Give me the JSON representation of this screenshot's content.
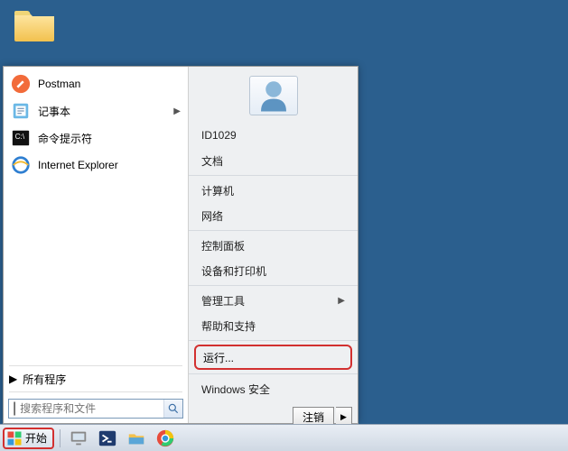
{
  "desktop": {
    "folder_icon": "folder-icon"
  },
  "start_menu": {
    "left": {
      "items": [
        {
          "label": "Postman",
          "has_submenu": false,
          "icon": "postman"
        },
        {
          "label": "记事本",
          "has_submenu": true,
          "icon": "notepad"
        },
        {
          "label": "命令提示符",
          "has_submenu": false,
          "icon": "cmd"
        },
        {
          "label": "Internet Explorer",
          "has_submenu": false,
          "icon": "ie"
        }
      ],
      "all_programs": "所有程序",
      "search_placeholder": "搜索程序和文件"
    },
    "right": {
      "username": "ID1029",
      "items_top": [
        "文档",
        "计算机",
        "网络"
      ],
      "items_mid": [
        "控制面板",
        "设备和打印机"
      ],
      "items_bot": [
        {
          "label": "管理工具",
          "has_submenu": true
        },
        {
          "label": "帮助和支持",
          "has_submenu": false
        }
      ],
      "run_label": "运行...",
      "security_label": "Windows 安全",
      "logoff_label": "注销"
    }
  },
  "taskbar": {
    "start_label": "开始",
    "pins": [
      "server-manager",
      "powershell",
      "explorer",
      "chrome"
    ]
  }
}
